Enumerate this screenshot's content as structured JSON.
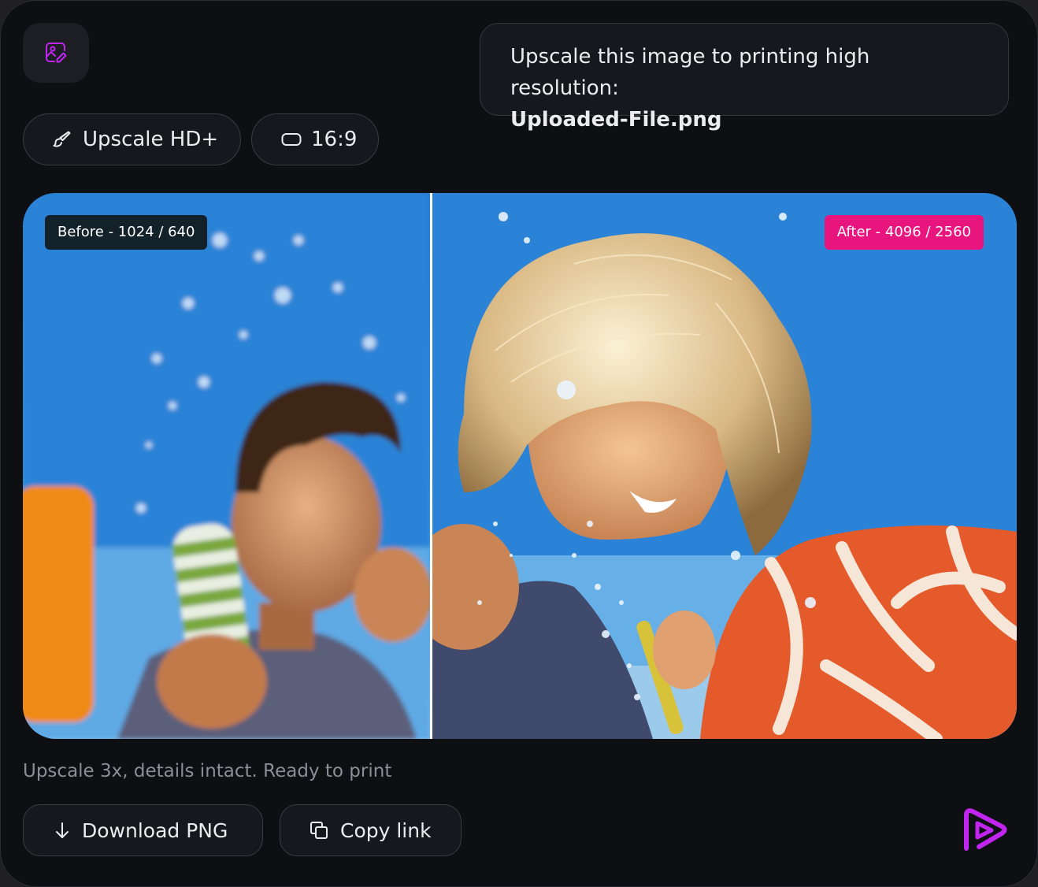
{
  "prompt": {
    "line1": "Upscale this image to printing high resolution:",
    "line2": "Uploaded-File.png"
  },
  "options": {
    "mode_label": "Upscale HD+",
    "aspect_label": "16:9"
  },
  "comparison": {
    "before_label": "Before - 1024 / 640",
    "after_label": "After - 4096 / 2560",
    "divider_position_fraction": 0.41
  },
  "caption": "Upscale 3x, details intact. Ready to print",
  "actions": {
    "download_label": "Download PNG",
    "copy_label": "Copy link"
  },
  "icons": {
    "top_left": "image-edit-icon",
    "mode": "brush-icon",
    "aspect": "rectangle-icon",
    "download": "arrow-down-icon",
    "copy": "copy-icon",
    "brand": "play-logo-icon"
  },
  "colors": {
    "accent": "#c026f0",
    "after_badge": "#e8157f",
    "before_badge": "#13212b",
    "card_background": "#0e0f13"
  }
}
